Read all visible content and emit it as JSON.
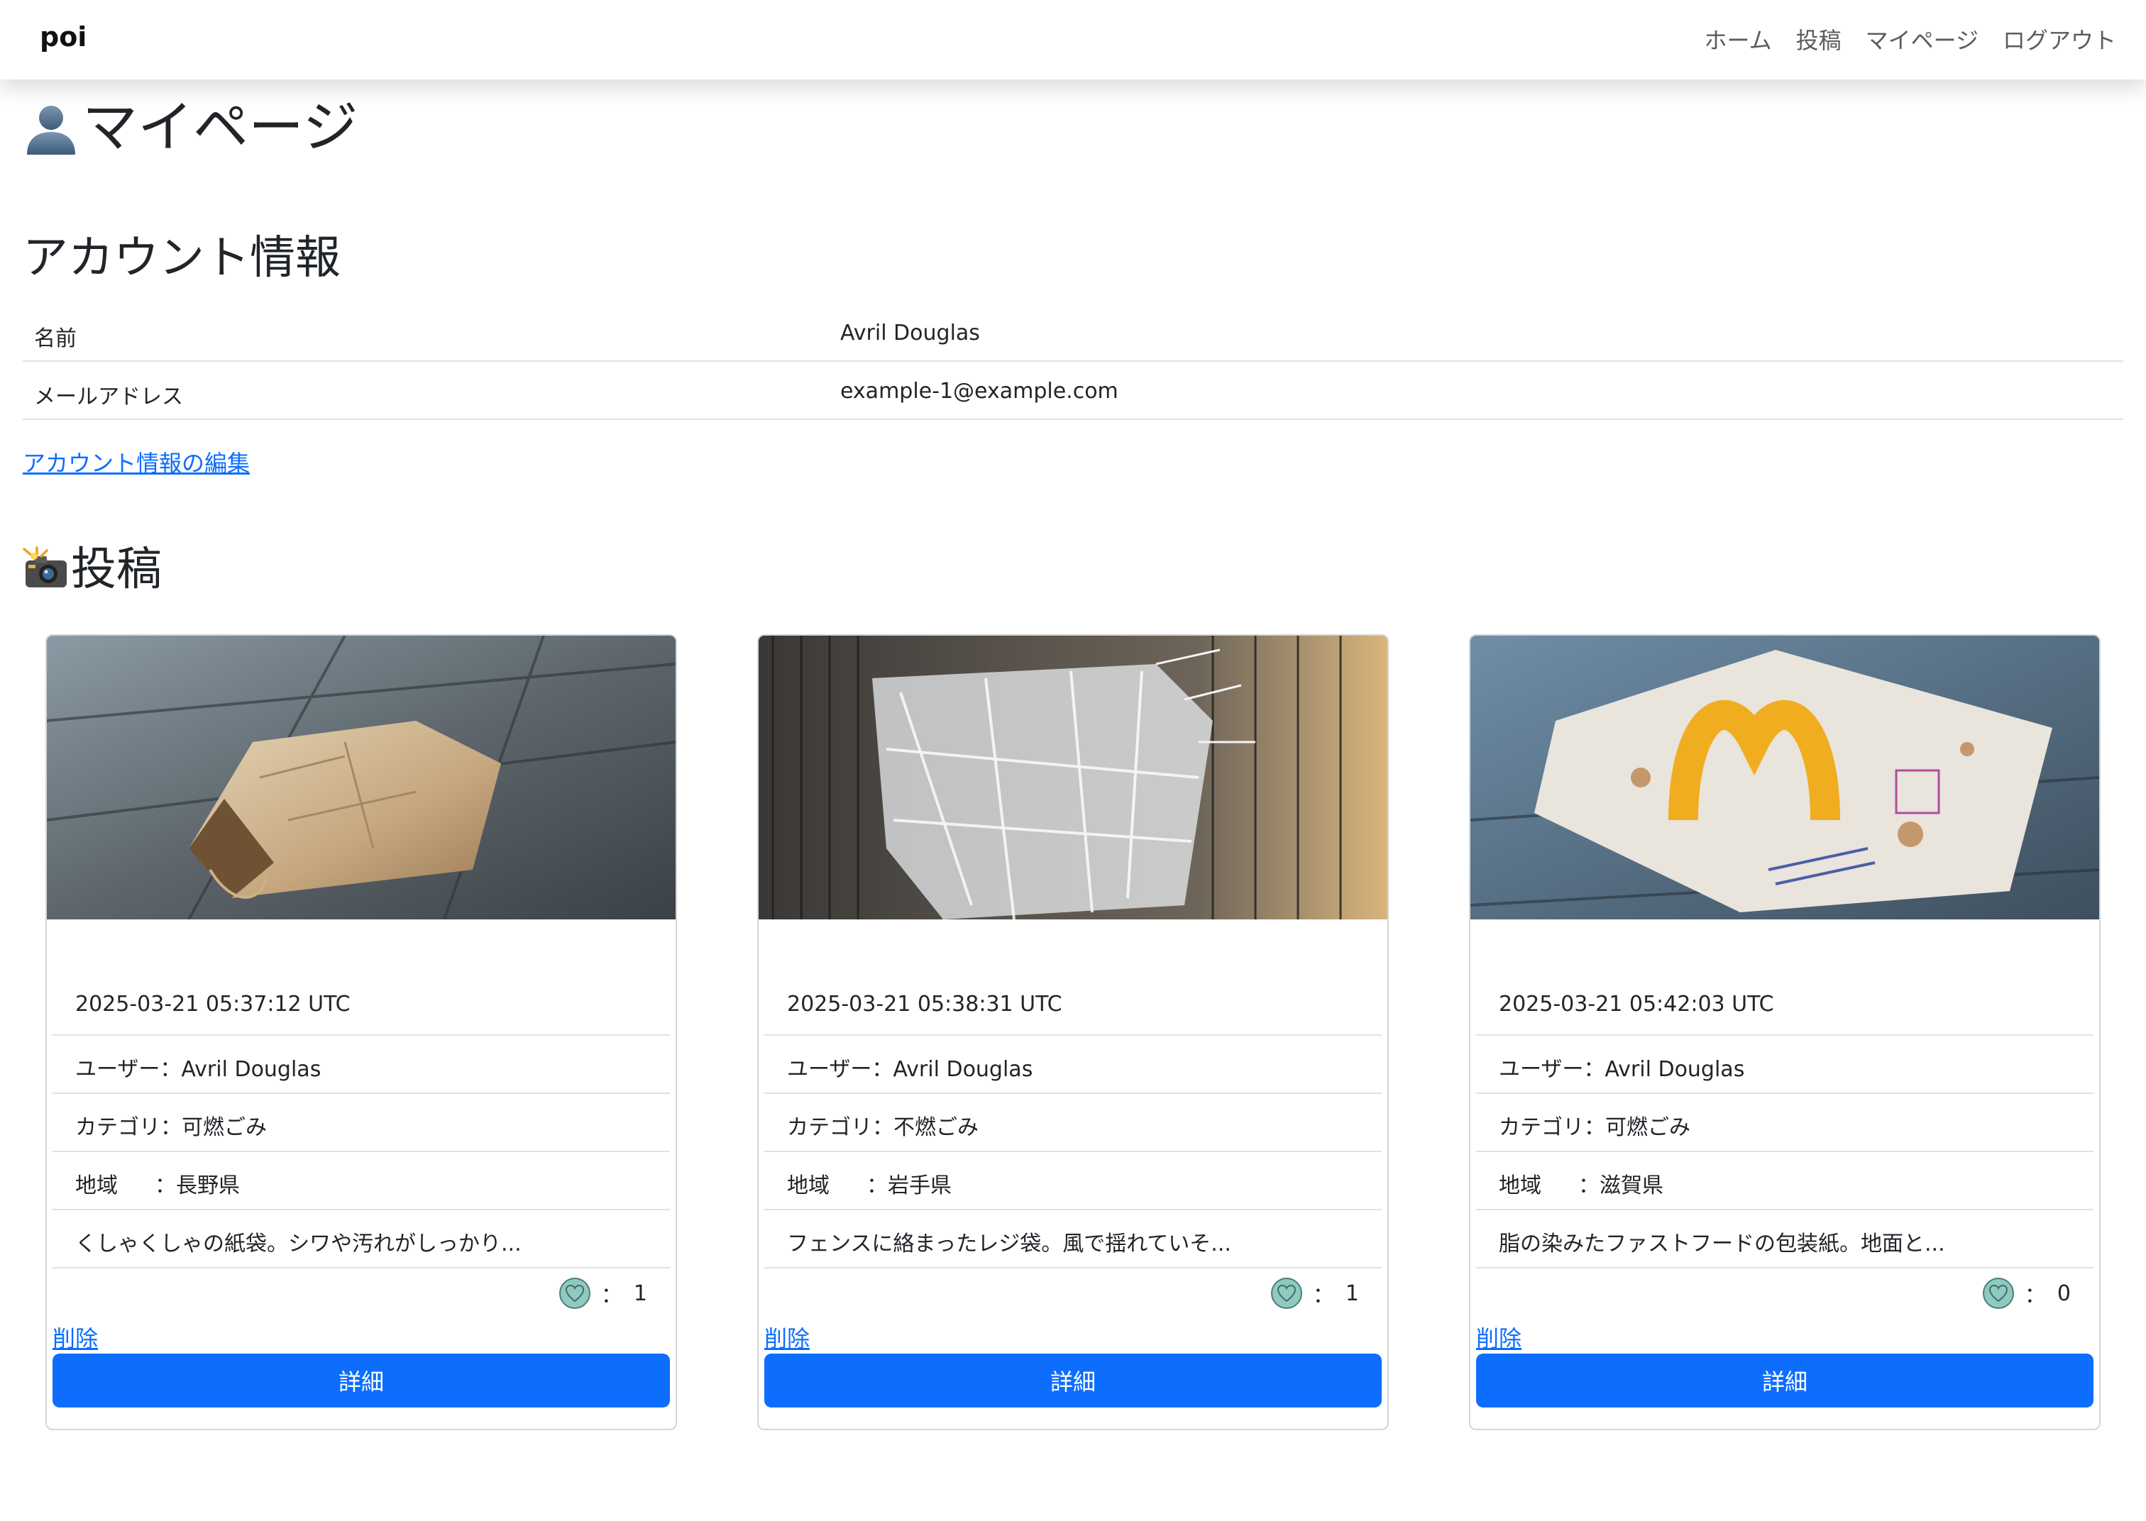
{
  "navbar": {
    "brand": "poi",
    "links": [
      "ホーム",
      "投稿",
      "マイページ",
      "ログアウト"
    ]
  },
  "page": {
    "title": "マイページ",
    "title_icon": "person-silhouette-icon"
  },
  "account": {
    "heading": "アカウント情報",
    "rows": [
      {
        "label": "名前",
        "value": "Avril Douglas"
      },
      {
        "label": "メールアドレス",
        "value": "example-1@example.com"
      }
    ],
    "edit_link": "アカウント情報の編集"
  },
  "posts": {
    "heading": "投稿",
    "heading_icon": "camera-flash-icon",
    "user_prefix": "ユーザー：",
    "category_prefix": "カテゴリ：",
    "region_label": "地域",
    "region_sep": "：",
    "like_sep": "：",
    "delete_label": "削除",
    "detail_label": "詳細",
    "items": [
      {
        "image": "crumpled-paper-bag-photo",
        "created_at": "2025-03-21 05:37:12 UTC",
        "user": "Avril Douglas",
        "category": "可燃ごみ",
        "region": "長野県",
        "description": "くしゃくしゃの紙袋。シワや汚れがしっかり...",
        "likes": "1"
      },
      {
        "image": "plastic-bag-on-fence-photo",
        "created_at": "2025-03-21 05:38:31 UTC",
        "user": "Avril Douglas",
        "category": "不燃ごみ",
        "region": "岩手県",
        "description": "フェンスに絡まったレジ袋。風で揺れていそ...",
        "likes": "1"
      },
      {
        "image": "fast-food-wrapper-photo",
        "created_at": "2025-03-21 05:42:03 UTC",
        "user": "Avril Douglas",
        "category": "可燃ごみ",
        "region": "滋賀県",
        "description": "脂の染みたファストフードの包装紙。地面と...",
        "likes": "0"
      }
    ]
  },
  "colors": {
    "primary": "#0d6efd",
    "border": "#dee2e6",
    "nav_text": "#5c5c5c",
    "heart": "#7fc4b8"
  }
}
